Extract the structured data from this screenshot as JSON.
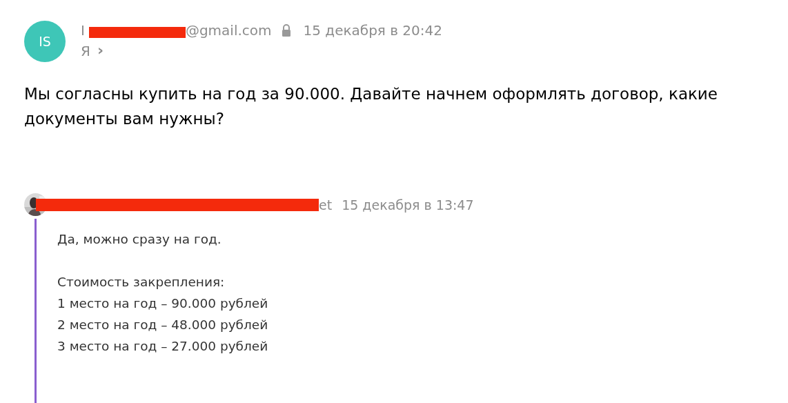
{
  "message": {
    "avatar": "IS",
    "sender_start": "I",
    "sender_redacted": true,
    "sender_end": "@gmail.com",
    "locked": true,
    "date": "15 декабря в 20:42",
    "recipient": "Я",
    "recipient_arrow": "›",
    "body": "Мы согласны купить на год за 90.000. Давайте начнем оформлять договор, какие документы вам нужны?"
  },
  "quote": {
    "sender_redacted": true,
    "sender_end": "et",
    "date": "15 декабря в 13:47",
    "paragraphs": [
      [
        "Да, можно сразу на год."
      ],
      [
        "Стоимость закрепления:",
        "1 место на год – 90.000 рублей",
        "2 место на год – 48.000 рублей",
        "3 место на год – 27.000 рублей"
      ]
    ]
  }
}
